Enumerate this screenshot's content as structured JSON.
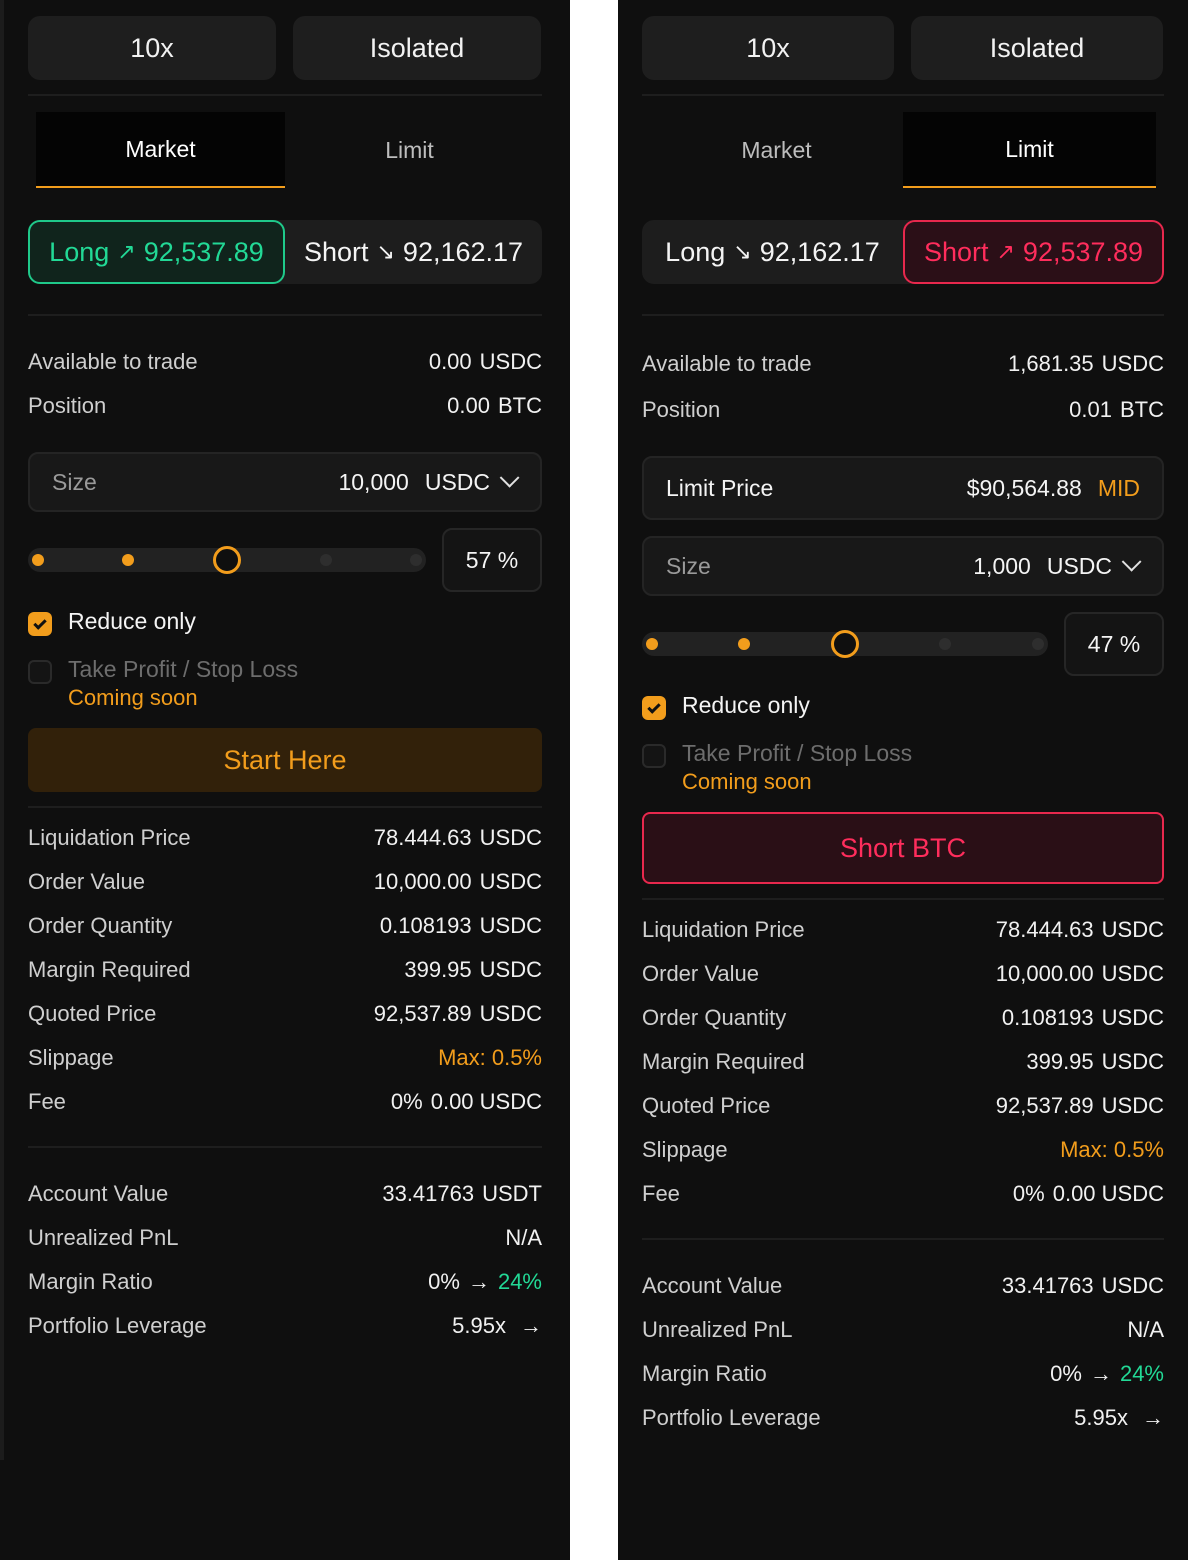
{
  "left": {
    "leverage": "10x",
    "margin_mode": "Isolated",
    "tabs": [
      "Market",
      "Limit"
    ],
    "active_tab": 0,
    "long_label": "Long",
    "long_arrow": "↗",
    "long_price": "92,537.89",
    "short_label": "Short",
    "short_arrow": "↘",
    "short_price": "92,162.17",
    "available_label": "Available to trade",
    "available_value": "0.00",
    "available_unit": "USDC",
    "position_label": "Position",
    "position_value": "0.00",
    "position_unit": "BTC",
    "size_label": "Size",
    "size_value": "10,000",
    "size_unit": "USDC",
    "slider_percent": 57,
    "percent_text": "57 %",
    "reduce_only_label": "Reduce only",
    "reduce_only_checked": true,
    "tpsl_label": "Take Profit / Stop Loss",
    "tpsl_note": "Coming soon",
    "cta_label": "Start Here",
    "details": [
      {
        "label": "Liquidation Price",
        "value": "78.444.63",
        "unit": "USDC"
      },
      {
        "label": "Order Value",
        "value": "10,000.00",
        "unit": "USDC"
      },
      {
        "label": "Order Quantity",
        "value": "0.108193",
        "unit": "USDC"
      },
      {
        "label": "Margin Required",
        "value": "399.95",
        "unit": "USDC"
      },
      {
        "label": "Quoted Price",
        "value": "92,537.89",
        "unit": "USDC"
      },
      {
        "label": "Slippage",
        "value": "Max: 0.5%",
        "unit": ""
      },
      {
        "label": "Fee",
        "value": "0%",
        "unit": "0.00 USDC"
      }
    ],
    "account": [
      {
        "label": "Account Value",
        "value": "33.41763",
        "unit": "USDT"
      },
      {
        "label": "Unrealized PnL",
        "value": "N/A",
        "unit": ""
      },
      {
        "label": "Margin Ratio",
        "value": "0%",
        "unit": "24%"
      },
      {
        "label": "Portfolio Leverage",
        "value": "5.95x",
        "unit": ""
      }
    ]
  },
  "right": {
    "leverage": "10x",
    "margin_mode": "Isolated",
    "tabs": [
      "Market",
      "Limit"
    ],
    "active_tab": 1,
    "long_label": "Long",
    "long_arrow": "↘",
    "long_price": "92,162.17",
    "short_label": "Short",
    "short_arrow": "↗",
    "short_price": "92,537.89",
    "available_label": "Available to trade",
    "available_value": "1,681.35",
    "available_unit": "USDC",
    "position_label": "Position",
    "position_value": "0.01",
    "position_unit": "BTC",
    "limit_label": "Limit Price",
    "limit_value": "$90,564.88",
    "limit_mid": "MID",
    "size_label": "Size",
    "size_value": "1,000",
    "size_unit": "USDC",
    "slider_percent": 47,
    "percent_text": "47 %",
    "reduce_only_label": "Reduce only",
    "reduce_only_checked": true,
    "tpsl_label": "Take Profit / Stop Loss",
    "tpsl_note": "Coming soon",
    "cta_label": "Short BTC",
    "details": [
      {
        "label": "Liquidation Price",
        "value": "78.444.63",
        "unit": "USDC"
      },
      {
        "label": "Order Value",
        "value": "10,000.00",
        "unit": "USDC"
      },
      {
        "label": "Order Quantity",
        "value": "0.108193",
        "unit": "USDC"
      },
      {
        "label": "Margin Required",
        "value": "399.95",
        "unit": "USDC"
      },
      {
        "label": "Quoted Price",
        "value": "92,537.89",
        "unit": "USDC"
      },
      {
        "label": "Slippage",
        "value": "Max: 0.5%",
        "unit": ""
      },
      {
        "label": "Fee",
        "value": "0%",
        "unit": "0.00 USDC"
      }
    ],
    "account": [
      {
        "label": "Account Value",
        "value": "33.41763",
        "unit": "USDC"
      },
      {
        "label": "Unrealized PnL",
        "value": "N/A",
        "unit": ""
      },
      {
        "label": "Margin Ratio",
        "value": "0%",
        "unit": "24%"
      },
      {
        "label": "Portfolio Leverage",
        "value": "5.95x",
        "unit": ""
      }
    ]
  },
  "colors": {
    "accent": "#f29d1c",
    "long": "#22d996",
    "short": "#ff2d5c",
    "panel": "#0f0f0f"
  },
  "icons": {
    "arrow_up": "arrow-up-right-icon",
    "arrow_down": "arrow-down-right-icon",
    "chevron": "chevron-down-icon",
    "arrow_right": "arrow-right-icon"
  }
}
